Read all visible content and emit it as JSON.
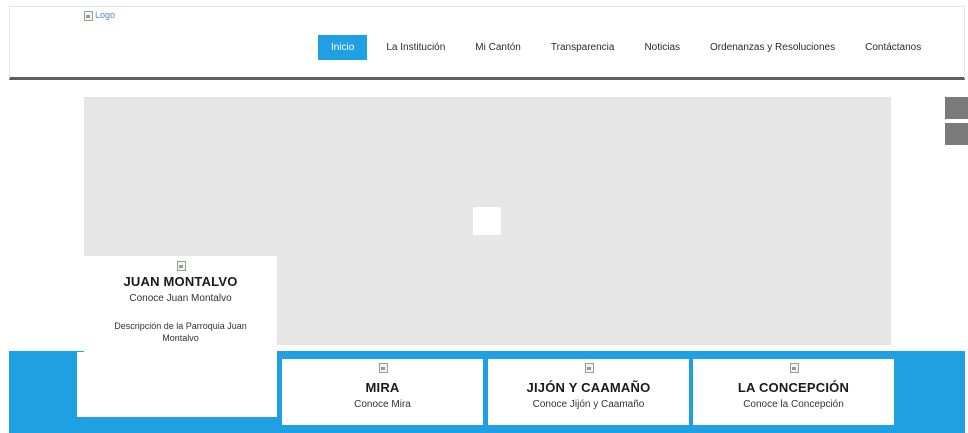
{
  "header": {
    "logo_alt": "Logo",
    "nav": [
      {
        "label": "Inicio",
        "active": true
      },
      {
        "label": "La Institución",
        "active": false
      },
      {
        "label": "Mi Cantón",
        "active": false
      },
      {
        "label": "Transparencia",
        "active": false
      },
      {
        "label": "Noticias",
        "active": false
      },
      {
        "label": "Ordenanzas y Resoluciones",
        "active": false
      },
      {
        "label": "Contáctanos",
        "active": false
      }
    ]
  },
  "parishes": {
    "featured": {
      "title": "JUAN MONTALVO",
      "subtitle": "Conoce Juan Montalvo",
      "description": "Descripción de la Parroquia Juan Montalvo"
    },
    "cards": [
      {
        "title": "MIRA",
        "subtitle": "Conoce Mira"
      },
      {
        "title": "JIJÓN Y CAAMAÑO",
        "subtitle": "Conoce Jijón y Caamaño"
      },
      {
        "title": "LA CONCEPCIÓN",
        "subtitle": "Conoce la Concepción"
      }
    ]
  },
  "colors": {
    "accent": "#1fa0e2",
    "slider_bg": "#e6e6e6",
    "header_border": "#5f5f5f",
    "side_button": "#7a7a7a"
  },
  "icons": {
    "broken_image": "broken-image-icon"
  }
}
